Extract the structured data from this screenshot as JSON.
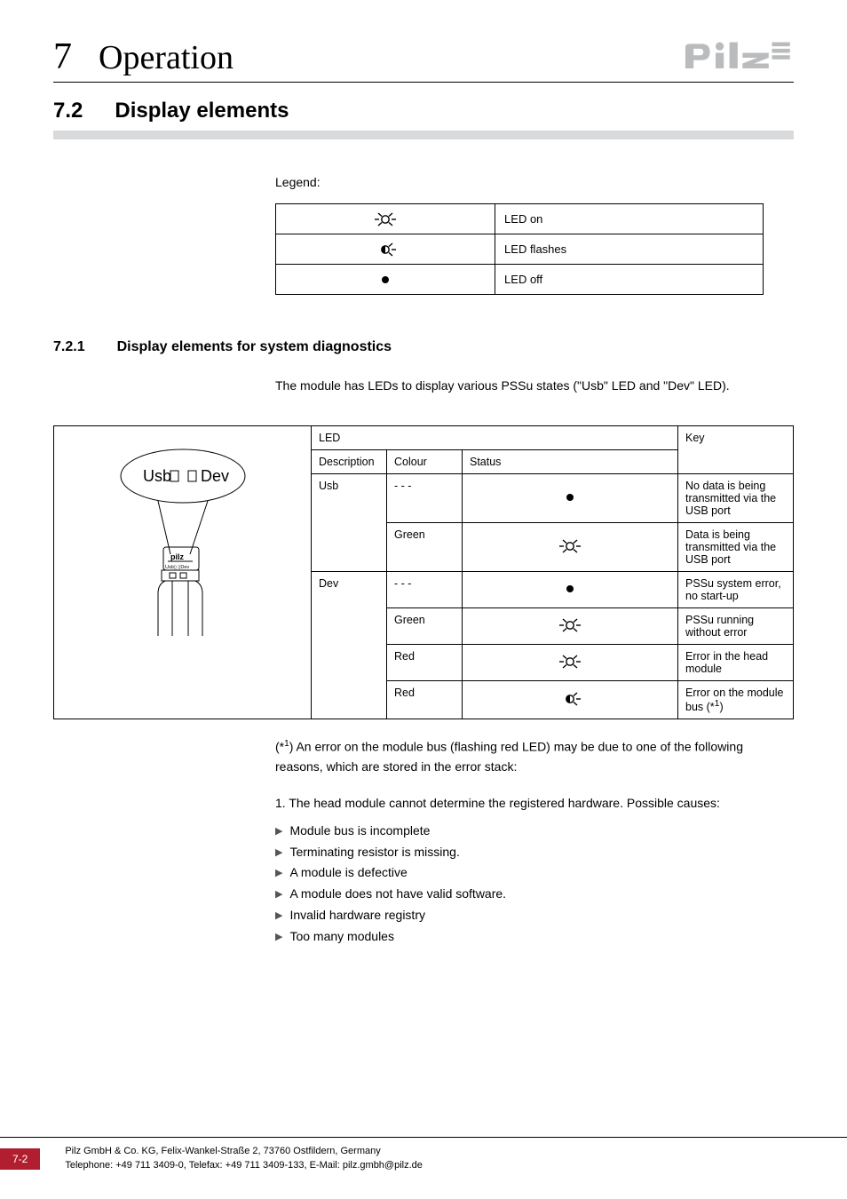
{
  "header": {
    "chapter_num": "7",
    "chapter_title": "Operation",
    "logo_alt": "pilz"
  },
  "section": {
    "number": "7.2",
    "title": "Display elements"
  },
  "legend": {
    "label": "Legend:",
    "rows": [
      {
        "icon": "led-on",
        "text": "LED on"
      },
      {
        "icon": "led-flash",
        "text": "LED flashes"
      },
      {
        "icon": "led-off",
        "text": "LED off"
      }
    ]
  },
  "subsection": {
    "number": "7.2.1",
    "title": "Display elements for system diagnostics",
    "intro": "The module has LEDs to display various PSSu states (\"Usb\" LED and \"Dev\" LED)."
  },
  "table": {
    "headers": {
      "led": "LED",
      "key": "Key",
      "description": "Description",
      "colour": "Colour",
      "status": "Status"
    },
    "diagram_labels": {
      "usb": "Usb",
      "dev": "Dev"
    },
    "rows": [
      {
        "desc": "Usb",
        "colour": "- - -",
        "status_icon": "led-off",
        "key": "No data is being transmitted via the USB port"
      },
      {
        "desc": "",
        "colour": "Green",
        "status_icon": "led-on",
        "key": "Data is being transmitted via the USB port"
      },
      {
        "desc": "Dev",
        "colour": "- - -",
        "status_icon": "led-off",
        "key": "PSSu system error, no start-up"
      },
      {
        "desc": "",
        "colour": "Green",
        "status_icon": "led-on",
        "key": "PSSu running without error"
      },
      {
        "desc": "",
        "colour": "Red",
        "status_icon": "led-on",
        "key": "Error in the head module"
      },
      {
        "desc": "",
        "colour": "Red",
        "status_icon": "led-flash",
        "key_html": "Error on the module bus (*<sup>1</sup>)"
      }
    ]
  },
  "footnote": {
    "marker": "(*1)",
    "text": "An error on the module bus (flashing red LED) may be due to one of the following reasons, which are stored in the error stack:"
  },
  "causes": {
    "intro": "1. The head module cannot determine the registered hardware. Possible causes:",
    "items": [
      "Module bus is incomplete",
      "Terminating resistor is missing.",
      "A module is defective",
      "A module does not have valid software.",
      "Invalid hardware registry",
      "Too many modules"
    ]
  },
  "footer": {
    "page": "7-2",
    "line1": "Pilz GmbH & Co. KG, Felix-Wankel-Straße 2, 73760 Ostfildern, Germany",
    "line2": "Telephone: +49 711 3409-0, Telefax: +49 711 3409-133, E-Mail: pilz.gmbh@pilz.de"
  }
}
